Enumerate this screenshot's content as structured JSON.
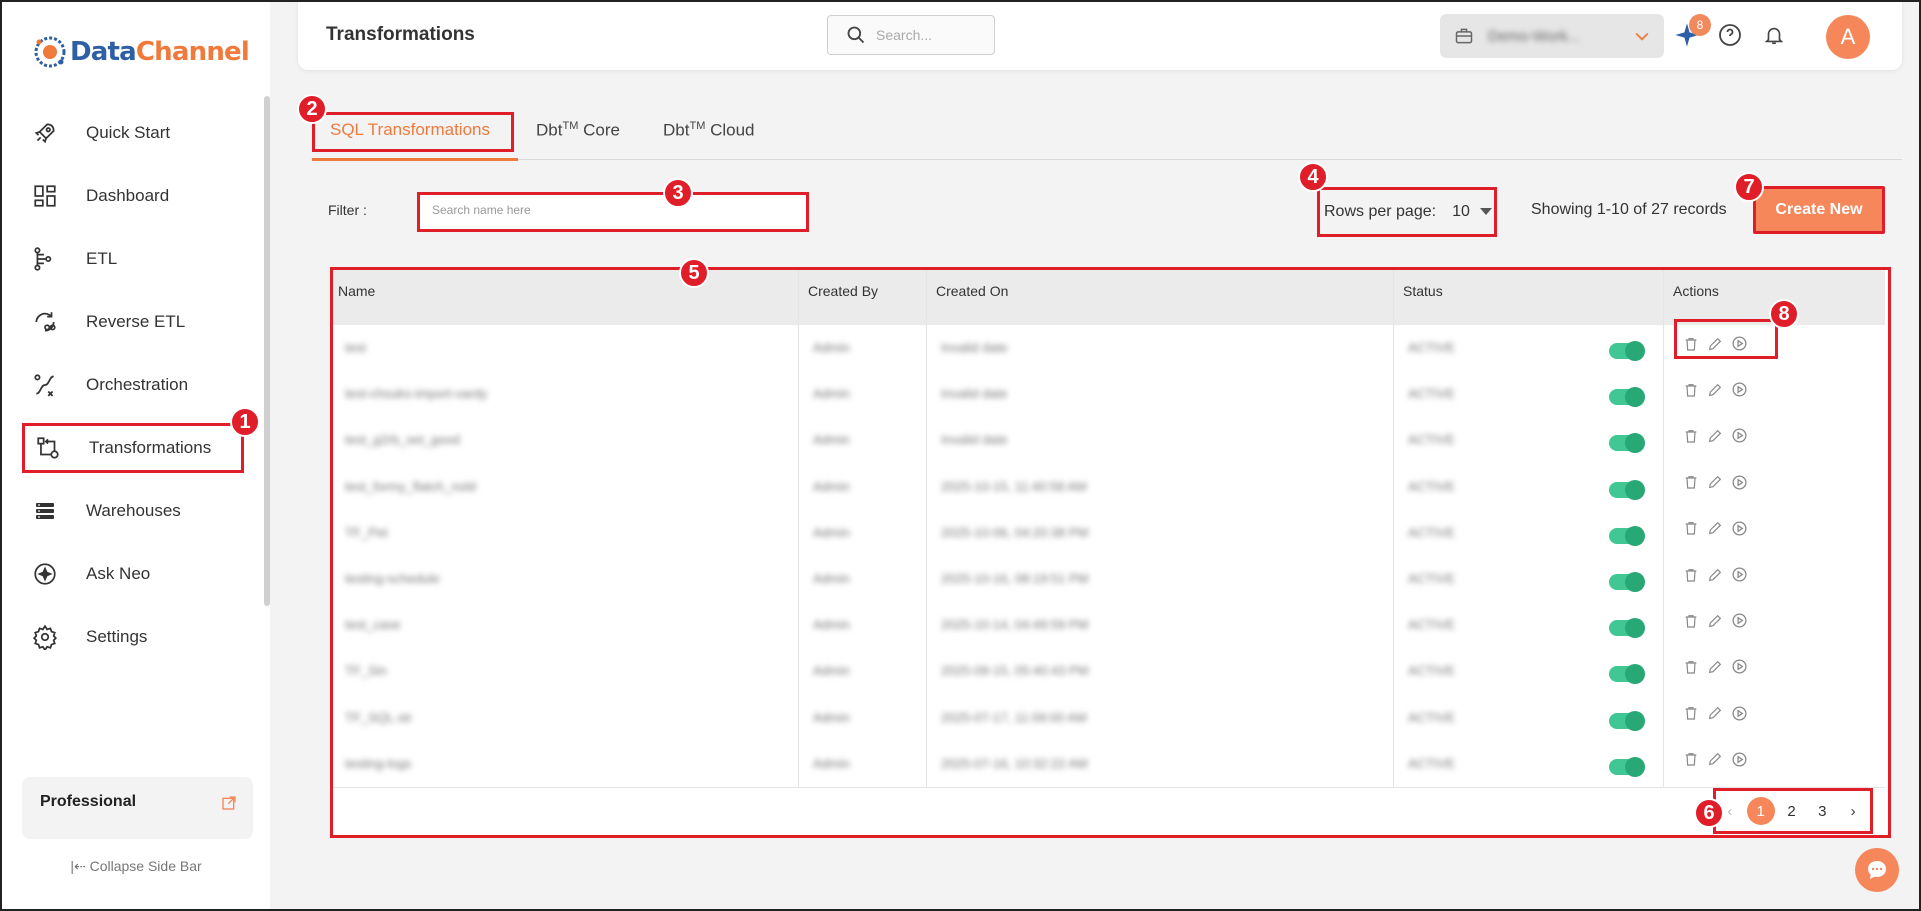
{
  "app": {
    "logo_text_primary": "Data",
    "logo_text_secondary": "Channel"
  },
  "sidebar": {
    "items": [
      {
        "label": "Quick Start",
        "icon": "rocket-icon"
      },
      {
        "label": "Dashboard",
        "icon": "dashboard-grid-icon"
      },
      {
        "label": "ETL",
        "icon": "etl-flow-icon"
      },
      {
        "label": "Reverse ETL",
        "icon": "reverse-etl-icon"
      },
      {
        "label": "Orchestration",
        "icon": "orchestration-icon"
      },
      {
        "label": "Transformations",
        "icon": "transformations-icon",
        "active": true
      },
      {
        "label": "Warehouses",
        "icon": "warehouse-stack-icon"
      },
      {
        "label": "Ask Neo",
        "icon": "sparkle-icon"
      },
      {
        "label": "Settings",
        "icon": "gear-icon"
      }
    ],
    "plan_label": "Professional",
    "collapse_label": "Collapse Side Bar"
  },
  "header": {
    "title": "Transformations",
    "search_placeholder": "Search...",
    "workspace_name": "Demo-Work...",
    "notification_count": "8",
    "avatar_initial": "A"
  },
  "tabs": [
    {
      "label": "SQL Transformations",
      "active": true
    },
    {
      "label": "Dbt",
      "sup": "TM",
      "suffix": " Core"
    },
    {
      "label": "Dbt",
      "sup": "TM",
      "suffix": " Cloud"
    }
  ],
  "filter": {
    "label": "Filter :",
    "placeholder": "Search name here"
  },
  "pagination": {
    "rows_label": "Rows per page:",
    "rows_value": "10",
    "showing_text": "Showing 1-10 of 27 records",
    "pages": [
      "1",
      "2",
      "3"
    ],
    "current_page": "1"
  },
  "create_button_label": "Create New",
  "table": {
    "columns": [
      "Name",
      "Created By",
      "Created On",
      "Status",
      "Actions"
    ],
    "rows": [
      {
        "name": "test",
        "created_by": "Admin",
        "created_on": "Invalid date",
        "status": "ACTIVE"
      },
      {
        "name": "test-chsuks-import-vardy",
        "created_by": "Admin",
        "created_on": "Invalid date",
        "status": "ACTIVE"
      },
      {
        "name": "test_g2rb_set_good",
        "created_by": "Admin",
        "created_on": "Invalid date",
        "status": "ACTIVE"
      },
      {
        "name": "test_formy_flatch_nold",
        "created_by": "Admin",
        "created_on": "2025-10-15, 11:40:58 AM",
        "status": "ACTIVE"
      },
      {
        "name": "TF_Pet",
        "created_by": "Admin",
        "created_on": "2025-10-06, 04:20:38 PM",
        "status": "ACTIVE"
      },
      {
        "name": "testing-schedule",
        "created_by": "Admin",
        "created_on": "2025-10-16, 08:19:51 PM",
        "status": "ACTIVE"
      },
      {
        "name": "test_case",
        "created_by": "Admin",
        "created_on": "2025-10-14, 04:49:59 PM",
        "status": "ACTIVE"
      },
      {
        "name": "TF_Sin",
        "created_by": "Admin",
        "created_on": "2025-09-15, 05:40:43 PM",
        "status": "ACTIVE"
      },
      {
        "name": "TF_SQL.str",
        "created_by": "Admin",
        "created_on": "2025-07-17, 11:09:00 AM",
        "status": "ACTIVE"
      },
      {
        "name": "testing-logs",
        "created_by": "Admin",
        "created_on": "2025-07-16, 10:32:22 AM",
        "status": "ACTIVE"
      }
    ]
  },
  "markers": [
    "1",
    "2",
    "3",
    "4",
    "5",
    "6",
    "7",
    "8"
  ],
  "colors": {
    "accent": "#f5875a",
    "annotation": "#e01e2a",
    "toggle_on": "#41c794"
  }
}
